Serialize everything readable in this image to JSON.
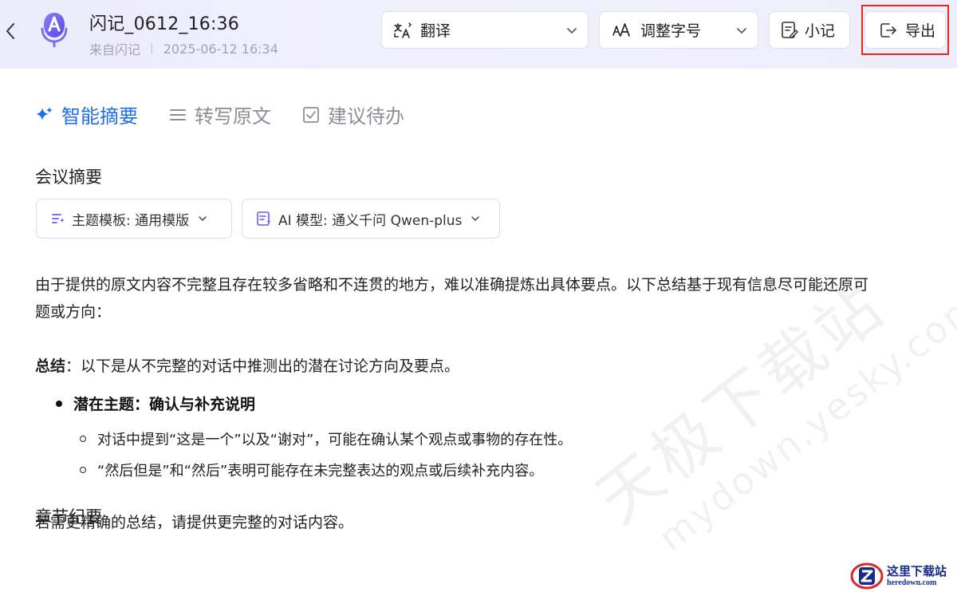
{
  "header": {
    "title": "闪记_0612_16:36",
    "source": "来自闪记",
    "separator": "|",
    "datetime": "2025-06-12 16:34",
    "translate_label": "翻译",
    "font_label": "调整字号",
    "note_label": "小记",
    "export_label": "导出",
    "accent_color": "#6a5cf0",
    "highlight_color": "#e5281e"
  },
  "tabs": [
    {
      "label": "智能摘要",
      "icon": "sparkle-icon",
      "active": true
    },
    {
      "label": "转写原文",
      "icon": "list-icon",
      "active": false
    },
    {
      "label": "建议待办",
      "icon": "checkbox-icon",
      "active": false
    }
  ],
  "summary": {
    "section_title": "会议摘要",
    "template_label": "主题模板: 通用模版",
    "model_label": "AI 模型: 通义千问 Qwen-plus",
    "intro_line1": "由于提供的原文内容不完整且存在较多省略和不连贯的地方，难以准确提炼出具体要点。以下总结基于现有信息尽可能还原可",
    "intro_line2": "题或方向：",
    "summary_bold": "总结",
    "summary_rest": "：以下是从不完整的对话中推测出的潜在讨论方向及要点。",
    "bullet_title": "潜在主题：确认与补充说明",
    "sub_items": [
      "对话中提到“这是一个”以及“谢对”，可能在确认某个观点或事物的存在性。",
      "“然后但是”和“然后”表明可能存在未完整表达的观点或后续补充内容。"
    ],
    "closing": "若需更精确的总结，请提供更完整的对话内容。"
  },
  "chapters": {
    "section_title": "章节纪要"
  },
  "watermark": {
    "line1": "天极下载站",
    "line2": "mydown.yesky.com"
  },
  "corner_logo": {
    "line1": "这里下载站",
    "line2": "heredown.com"
  }
}
